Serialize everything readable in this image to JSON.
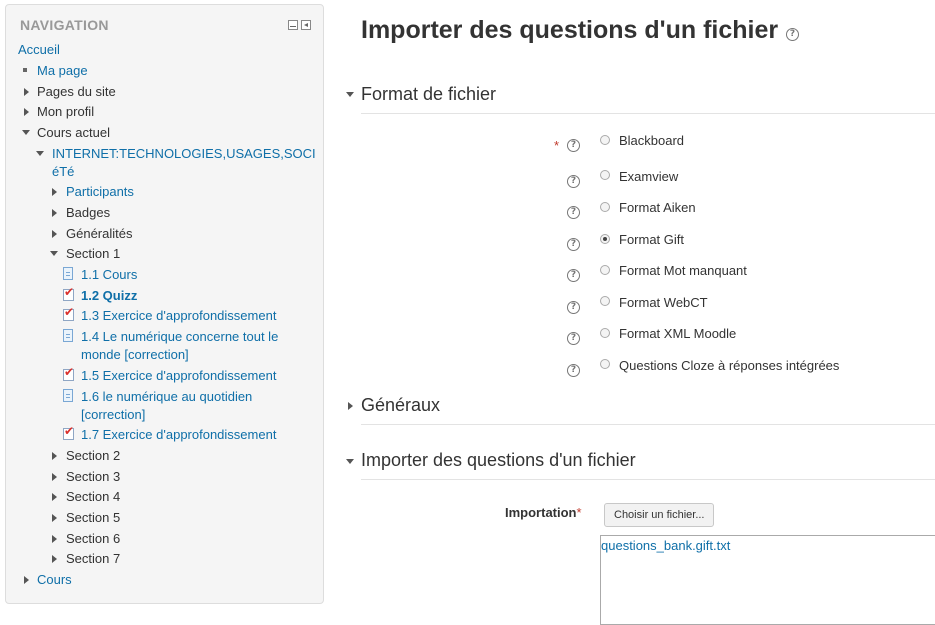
{
  "navigation": {
    "title": "NAVIGATION",
    "home": "Accueil",
    "my_page": "Ma page",
    "site_pages": "Pages du site",
    "my_profile": "Mon profil",
    "current_course": "Cours actuel",
    "course_name_line1": "INTERNET:TECHNOLOGIES,USAGES,SOCI",
    "course_name_line2": "éTé",
    "participants": "Participants",
    "badges": "Badges",
    "generalites": "Généralités",
    "section1": "Section 1",
    "activities": [
      {
        "label": "1.1 Cours",
        "icon": "page-icon"
      },
      {
        "label": "1.2 Quizz",
        "icon": "quiz-icon"
      },
      {
        "label": "1.3 Exercice d'approfondissement",
        "icon": "quiz-icon"
      },
      {
        "label_line1": "1.4 Le numérique concerne tout le",
        "label_line2": "monde [correction]",
        "icon": "page-icon"
      },
      {
        "label": "1.5 Exercice d'approfondissement",
        "icon": "quiz-icon"
      },
      {
        "label_line1": "1.6 le numérique au quotidien",
        "label_line2": "[correction]",
        "icon": "page-icon"
      },
      {
        "label": "1.7 Exercice d'approfondissement",
        "icon": "quiz-icon"
      }
    ],
    "sections": [
      "Section 2",
      "Section 3",
      "Section 4",
      "Section 5",
      "Section 6",
      "Section 7"
    ],
    "courses": "Cours"
  },
  "main": {
    "title": "Importer des questions d'un fichier",
    "format_section": "Format de fichier",
    "formats": [
      {
        "label": "Blackboard",
        "checked": false
      },
      {
        "label": "Examview",
        "checked": false
      },
      {
        "label": "Format Aiken",
        "checked": false
      },
      {
        "label": "Format Gift",
        "checked": true
      },
      {
        "label": "Format Mot manquant",
        "checked": false
      },
      {
        "label": "Format WebCT",
        "checked": false
      },
      {
        "label": "Format XML Moodle",
        "checked": false
      },
      {
        "label": "Questions Cloze à réponses intégrées",
        "checked": false
      }
    ],
    "general_section": "Généraux",
    "import_section": "Importer des questions d'un fichier",
    "import_label": "Importation",
    "required_mark": "*",
    "choose_file_button": "Choisir un fichier...",
    "selected_file": "questions_bank.gift.txt"
  },
  "colors": {
    "link": "#0f6fa8",
    "required": "#c0392b",
    "block_bg": "#f5f5f5"
  }
}
